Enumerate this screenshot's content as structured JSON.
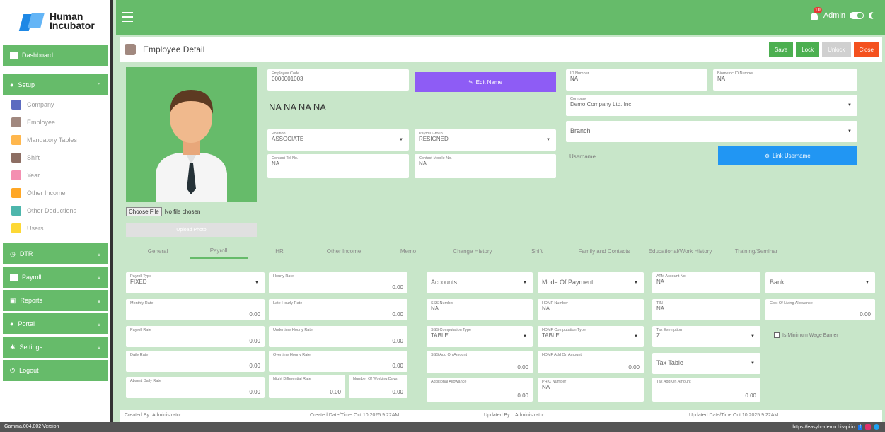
{
  "brand": {
    "name_line1": "Human",
    "name_line2": "Incubator"
  },
  "sidebar": {
    "dashboard": "Dashboard",
    "setup": "Setup",
    "setup_items": [
      "Company",
      "Employee",
      "Mandatory Tables",
      "Shift",
      "Year",
      "Other Income",
      "Other Deductions",
      "Users"
    ],
    "dtr": "DTR",
    "payroll": "Payroll",
    "reports": "Reports",
    "portal": "Portal",
    "settings": "Settings",
    "logout": "Logout"
  },
  "topbar": {
    "notif_count": "10",
    "user": "Admin"
  },
  "header": {
    "title": "Employee Detail",
    "buttons": {
      "save": "Save",
      "lock": "Lock",
      "unlock": "Unlock",
      "close": "Close"
    },
    "colors": {
      "save": "#4caf50",
      "lock": "#4caf50",
      "unlock": "#d0d0d0",
      "close": "#f4511e"
    }
  },
  "employee": {
    "code_label": "Employee Code",
    "code": "0000001003",
    "edit_name": "Edit Name",
    "full_name": "NA NA  NA NA",
    "position_label": "Position",
    "position": "ASSOCIATE",
    "payroll_group_label": "Payroll Group",
    "payroll_group": "RESIGNED",
    "contact_tel_label": "Contact Tel No.",
    "contact_tel": "NA",
    "contact_mobile_label": "Contact Mobile No.",
    "contact_mobile": "NA",
    "id_number_label": "ID Number",
    "id_number": "NA",
    "biometric_label": "Biometric ID Number",
    "biometric": "NA",
    "company_label": "Company",
    "company": "Demo Company Ltd. Inc.",
    "branch": "Branch",
    "username_label": "Username",
    "link_username": "Link Username",
    "choose_file": "Choose File",
    "no_file": "No file chosen",
    "upload_photo": "Upload Photo"
  },
  "tabs": [
    "General",
    "Payroll",
    "HR",
    "Other Income",
    "Memo",
    "Change History",
    "Shift",
    "Family and Contacts",
    "Educational/Work History",
    "Training/Seminar"
  ],
  "payroll": {
    "payroll_type_label": "Payroll Type",
    "payroll_type": "FIXED",
    "hourly_rate_label": "Hourly Rate",
    "hourly_rate": "0.00",
    "accounts": "Accounts",
    "mode_of_payment": "Mode Of Payment",
    "atm_label": "ATM Account No.",
    "atm": "NA",
    "bank": "Bank",
    "monthly_rate_label": "Monthly Rate",
    "monthly_rate": "0.00",
    "late_hourly_label": "Late Hourly Rate",
    "late_hourly": "0.00",
    "sss_label": "SSS Number",
    "sss": "NA",
    "hdmf_label": "HDMF Number",
    "hdmf": "NA",
    "tin_label": "TIN",
    "tin": "NA",
    "cola_label": "Cost Of Living Allowance",
    "cola": "0.00",
    "payroll_rate_label": "Payroll Rate",
    "payroll_rate": "0.00",
    "undertime_label": "Undertime Hourly Rate",
    "undertime": "0.00",
    "sss_comp_label": "SSS Computation Type",
    "sss_comp": "TABLE",
    "hdmf_comp_label": "HDMF Computation Type",
    "hdmf_comp": "TABLE",
    "tax_exempt_label": "Tax Exemption",
    "tax_exempt": "Z",
    "min_wage": "Is Minimum Wage Earner",
    "daily_rate_label": "Daily Rate",
    "daily_rate": "0.00",
    "overtime_label": "Overtime Hourly Rate",
    "overtime": "0.00",
    "sss_addon_label": "SSS Add On Amount",
    "sss_addon": "0.00",
    "hdmf_addon_label": "HDMF Add On Amount",
    "hdmf_addon": "0.00",
    "tax_table": "Tax Table",
    "absent_label": "Absent Daily Rate",
    "absent": "0.00",
    "night_diff_label": "Night Differential Rate",
    "night_diff": "0.00",
    "working_days_label": "Number Of Working Days",
    "working_days": "0.00",
    "additional_label": "Additional Allowance",
    "additional": "0.00",
    "phic_label": "PHIC Number",
    "phic": "NA",
    "tax_addon_label": "Tax Add On Amount",
    "tax_addon": "0.00"
  },
  "footer": {
    "created_by_label": "Created By:",
    "created_by": "Administrator",
    "created_dt_label": "Created Date/Time:",
    "created_dt": "Oct 10 2025 9:22AM",
    "updated_by_label": "Updated By:",
    "updated_by": "Administrator",
    "updated_dt_label": "Updated Date/Time:",
    "updated_dt": "Oct 10 2025 9:22AM"
  },
  "version": "Gamma.004.002 Version",
  "url": "https://easyhr-demo.hi-api.io"
}
